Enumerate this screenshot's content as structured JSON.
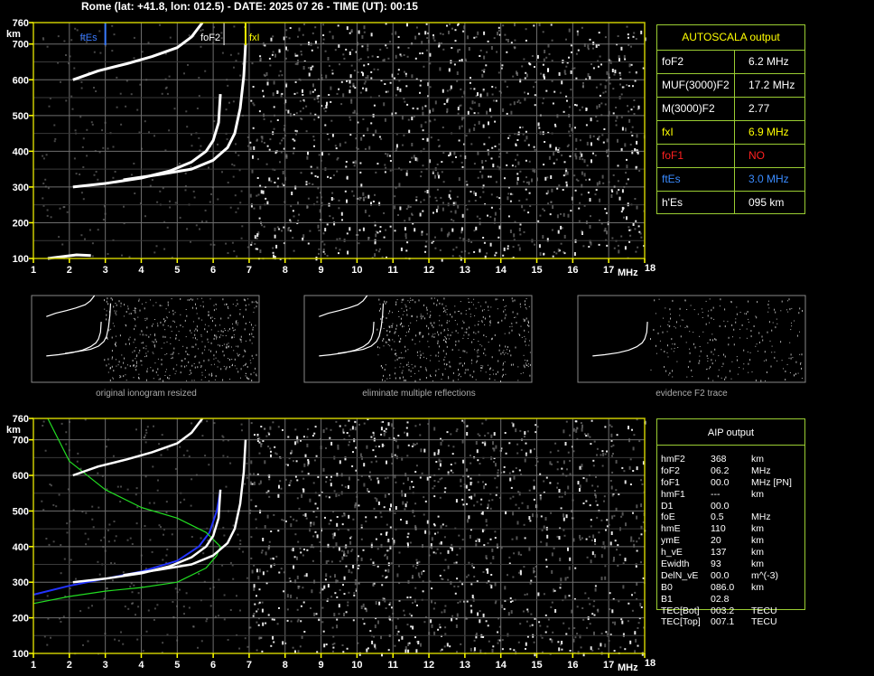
{
  "header": {
    "title": "Rome (lat: +41.8, lon: 012.5) - DATE: 2025 07 26 - TIME (UT): 00:15"
  },
  "colors": {
    "frame": "#c9c900",
    "grid": "#6e6e6e",
    "tick": "#ffff00",
    "fxl": "#ffff00",
    "ftEs": "#3a7bff",
    "green": "#22dd22",
    "blue": "#2233ff",
    "table_border": "#9acd32"
  },
  "autoscala": {
    "title": "AUTOSCALA output",
    "rows": [
      {
        "key": "foF2",
        "value": "6.2 MHz",
        "color": "#ffffff"
      },
      {
        "key": "MUF(3000)F2",
        "value": "17.2 MHz",
        "color": "#ffffff"
      },
      {
        "key": "M(3000)F2",
        "value": "2.77",
        "color": "#ffffff"
      },
      {
        "key": "fxI",
        "value": "6.9 MHz",
        "color": "#ffff00"
      },
      {
        "key": "foF1",
        "value": "NO",
        "color": "#ff2020"
      },
      {
        "key": "ftEs",
        "value": "3.0 MHz",
        "color": "#3a8bff"
      },
      {
        "key": "h'Es",
        "value": "095     km",
        "color": "#ffffff"
      }
    ]
  },
  "aip": {
    "title": "AIP output",
    "rows": [
      {
        "p": "hmF2",
        "v": "368",
        "u": "km"
      },
      {
        "p": "foF2",
        "v": "06.2",
        "u": "MHz"
      },
      {
        "p": "foF1",
        "v": "00.0",
        "u": "MHz   [PN]"
      },
      {
        "p": "hmF1",
        "v": "---",
        "u": "km"
      },
      {
        "p": "D1",
        "v": "00.0",
        "u": ""
      },
      {
        "p": "foE",
        "v": "0.5",
        "u": "MHz"
      },
      {
        "p": "hmE",
        "v": "110",
        "u": "km"
      },
      {
        "p": "ymE",
        "v": "20",
        "u": "km"
      },
      {
        "p": "h_vE",
        "v": "137",
        "u": "km"
      },
      {
        "p": "Ewidth",
        "v": "93",
        "u": "km"
      },
      {
        "p": "DelN_vE",
        "v": "00.0",
        "u": "m^(-3)"
      },
      {
        "p": "B0",
        "v": "086.0",
        "u": "km"
      },
      {
        "p": "B1",
        "v": "02.8",
        "u": ""
      },
      {
        "p": "TEC[Bot]",
        "v": "003.2",
        "u": "TECU"
      },
      {
        "p": "TEC[Top]",
        "v": "007.1",
        "u": "TECU"
      }
    ]
  },
  "thumbnails": [
    {
      "caption": "original ionogram resized"
    },
    {
      "caption": "eliminate multiple reflections"
    },
    {
      "caption": "evidence F2 trace"
    }
  ],
  "chart_data": [
    {
      "type": "scatter",
      "name": "ionogram-top",
      "xlabel": "MHz",
      "ylabel": "km",
      "xlim": [
        1,
        18
      ],
      "ylim": [
        100,
        760
      ],
      "xticks": [
        "1",
        "2",
        "3",
        "4",
        "5",
        "6",
        "7",
        "8",
        "9",
        "10",
        "11",
        "12",
        "13",
        "14",
        "15",
        "16",
        "17",
        "18"
      ],
      "yticks": [
        "100",
        "200",
        "300",
        "400",
        "500",
        "600",
        "700",
        "760"
      ],
      "markers": [
        {
          "label": "ftEs",
          "x": 3.0,
          "color": "#3a7bff"
        },
        {
          "label": "foF2",
          "x": 6.2,
          "color": "#ffffff"
        },
        {
          "label": "fxI",
          "x": 6.9,
          "color": "#ffff00"
        }
      ],
      "series": [
        {
          "values": [
            [
              2.1,
              300
            ],
            [
              3.0,
              310
            ],
            [
              4.0,
              325
            ],
            [
              4.8,
              345
            ],
            [
              5.4,
              370
            ],
            [
              5.8,
              400
            ],
            [
              6.0,
              430
            ],
            [
              6.15,
              480
            ],
            [
              6.2,
              560
            ]
          ]
        },
        {
          "values": [
            [
              3.5,
              320
            ],
            [
              4.5,
              335
            ],
            [
              5.4,
              350
            ],
            [
              6.0,
              375
            ],
            [
              6.4,
              410
            ],
            [
              6.6,
              450
            ],
            [
              6.75,
              520
            ],
            [
              6.85,
              610
            ],
            [
              6.9,
              700
            ]
          ]
        },
        {
          "values": [
            [
              2.1,
              600
            ],
            [
              2.8,
              625
            ],
            [
              3.6,
              645
            ],
            [
              4.3,
              665
            ],
            [
              5.0,
              690
            ],
            [
              5.4,
              720
            ],
            [
              5.7,
              760
            ]
          ]
        },
        {
          "values": [
            [
              1.4,
              100
            ],
            [
              1.8,
              105
            ],
            [
              2.2,
              110
            ],
            [
              2.6,
              108
            ]
          ]
        }
      ]
    },
    {
      "type": "line",
      "name": "ionogram-bottom",
      "xlabel": "MHz",
      "ylabel": "km",
      "xlim": [
        1,
        18
      ],
      "ylim": [
        100,
        760
      ],
      "xticks": [
        "1",
        "2",
        "3",
        "4",
        "5",
        "6",
        "7",
        "8",
        "9",
        "10",
        "11",
        "12",
        "13",
        "14",
        "15",
        "16",
        "17",
        "18"
      ],
      "yticks": [
        "100",
        "200",
        "300",
        "400",
        "500",
        "600",
        "700",
        "760"
      ],
      "series": [
        {
          "values": [
            [
              1.0,
              265
            ],
            [
              2.0,
              290
            ],
            [
              3.0,
              310
            ],
            [
              4.0,
              330
            ],
            [
              5.0,
              360
            ],
            [
              5.6,
              400
            ],
            [
              5.9,
              440
            ],
            [
              6.1,
              500
            ],
            [
              6.2,
              560
            ]
          ]
        },
        {
          "values": [
            [
              1.0,
              240
            ],
            [
              2.0,
              260
            ],
            [
              3.0,
              275
            ],
            [
              4.0,
              285
            ],
            [
              5.0,
              300
            ],
            [
              5.8,
              340
            ],
            [
              6.1,
              375
            ],
            [
              6.2,
              400
            ],
            [
              5.8,
              440
            ],
            [
              5.0,
              480
            ],
            [
              4.0,
              510
            ],
            [
              3.0,
              560
            ],
            [
              2.0,
              640
            ],
            [
              1.4,
              760
            ]
          ]
        },
        {
          "values": [
            [
              2.1,
              300
            ],
            [
              3.0,
              310
            ],
            [
              4.0,
              325
            ],
            [
              4.8,
              345
            ],
            [
              5.4,
              370
            ],
            [
              5.8,
              400
            ],
            [
              6.0,
              430
            ],
            [
              6.15,
              480
            ],
            [
              6.2,
              560
            ]
          ]
        },
        {
          "values": [
            [
              3.5,
              320
            ],
            [
              4.5,
              335
            ],
            [
              5.4,
              350
            ],
            [
              6.0,
              375
            ],
            [
              6.4,
              410
            ],
            [
              6.6,
              450
            ],
            [
              6.75,
              520
            ],
            [
              6.85,
              610
            ],
            [
              6.9,
              700
            ]
          ]
        },
        {
          "values": [
            [
              2.1,
              600
            ],
            [
              2.8,
              625
            ],
            [
              3.6,
              645
            ],
            [
              4.3,
              665
            ],
            [
              5.0,
              690
            ],
            [
              5.4,
              720
            ],
            [
              5.7,
              760
            ]
          ]
        }
      ]
    }
  ]
}
